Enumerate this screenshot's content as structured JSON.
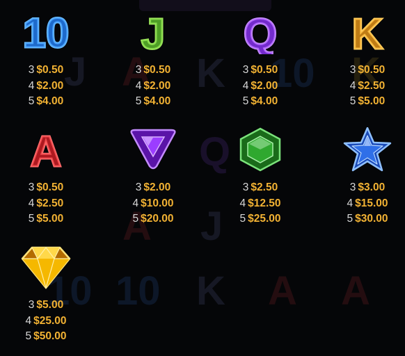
{
  "colors": {
    "background": "#050608",
    "count_text": "#d7d7d7",
    "payout_text": "#f2b233",
    "ten": "#2f8fff",
    "jack": "#6fcf3a",
    "queen": "#9b3dff",
    "king": "#f5a623",
    "ace": "#e0262e",
    "purple_gem": "#8a2be2",
    "green_gem": "#2fa82f",
    "blue_star": "#2f6fe8",
    "yellow_diamond": "#f5b800"
  },
  "symbols": [
    {
      "name": "ten",
      "glyph": "10",
      "icon": "ten-icon",
      "pays": [
        {
          "count": "3",
          "amount": "$0.50"
        },
        {
          "count": "4",
          "amount": "$2.00"
        },
        {
          "count": "5",
          "amount": "$4.00"
        }
      ]
    },
    {
      "name": "jack",
      "glyph": "J",
      "icon": "jack-icon",
      "pays": [
        {
          "count": "3",
          "amount": "$0.50"
        },
        {
          "count": "4",
          "amount": "$2.00"
        },
        {
          "count": "5",
          "amount": "$4.00"
        }
      ]
    },
    {
      "name": "queen",
      "glyph": "Q",
      "icon": "queen-icon",
      "pays": [
        {
          "count": "3",
          "amount": "$0.50"
        },
        {
          "count": "4",
          "amount": "$2.00"
        },
        {
          "count": "5",
          "amount": "$4.00"
        }
      ]
    },
    {
      "name": "king",
      "glyph": "K",
      "icon": "king-icon",
      "pays": [
        {
          "count": "3",
          "amount": "$0.50"
        },
        {
          "count": "4",
          "amount": "$2.50"
        },
        {
          "count": "5",
          "amount": "$5.00"
        }
      ]
    },
    {
      "name": "ace",
      "glyph": "A",
      "icon": "ace-icon",
      "pays": [
        {
          "count": "3",
          "amount": "$0.50"
        },
        {
          "count": "4",
          "amount": "$2.50"
        },
        {
          "count": "5",
          "amount": "$5.00"
        }
      ]
    },
    {
      "name": "purple-gem",
      "icon": "purple-triangle-gem-icon",
      "pays": [
        {
          "count": "3",
          "amount": "$2.00"
        },
        {
          "count": "4",
          "amount": "$10.00"
        },
        {
          "count": "5",
          "amount": "$20.00"
        }
      ]
    },
    {
      "name": "green-gem",
      "icon": "green-hexagon-gem-icon",
      "pays": [
        {
          "count": "3",
          "amount": "$2.50"
        },
        {
          "count": "4",
          "amount": "$12.50"
        },
        {
          "count": "5",
          "amount": "$25.00"
        }
      ]
    },
    {
      "name": "blue-star",
      "icon": "blue-star-icon",
      "pays": [
        {
          "count": "3",
          "amount": "$3.00"
        },
        {
          "count": "4",
          "amount": "$15.00"
        },
        {
          "count": "5",
          "amount": "$30.00"
        }
      ]
    },
    {
      "name": "yellow-diamond",
      "icon": "yellow-diamond-icon",
      "pays": [
        {
          "count": "3",
          "amount": "$5.00"
        },
        {
          "count": "4",
          "amount": "$25.00"
        },
        {
          "count": "5",
          "amount": "$50.00"
        }
      ]
    }
  ]
}
